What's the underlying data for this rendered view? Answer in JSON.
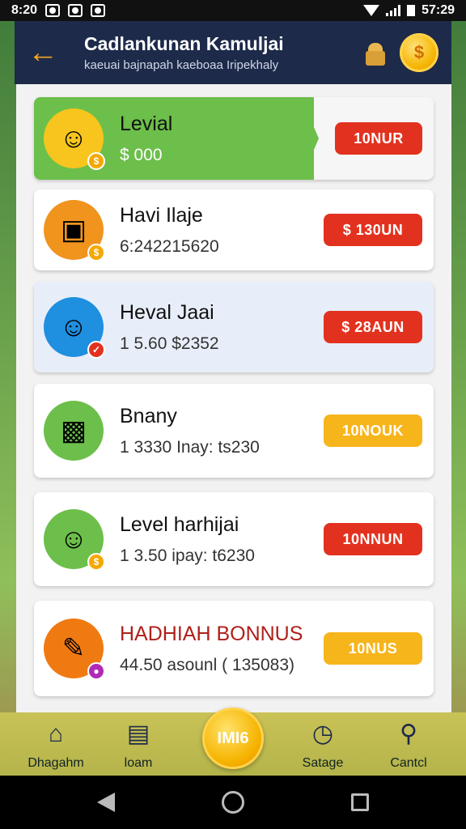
{
  "status_bar": {
    "time_left": "8:20",
    "time_right": "57:29"
  },
  "header": {
    "title": "Cadlankunan Kamuljai",
    "subtitle": "kaeuai bajnapah kaeboaa Iripekhaly",
    "back_icon": "arrow-left-icon",
    "gift_icon": "gift-box-icon",
    "coin_icon": "gold-coin-icon"
  },
  "cards": [
    {
      "title": "Levial",
      "subtitle": "$ 000",
      "button": "10NUR",
      "button_color": "#e2321f",
      "avatar_icon": "boy-avatar-icon"
    },
    {
      "title": "Havi Ilaje",
      "subtitle": "6:242215620",
      "button": "$ 130UN",
      "button_color": "#e2321f",
      "avatar_icon": "tablet-avatar-icon"
    },
    {
      "title": "Heval Jaai",
      "subtitle": "1 5.60  $2352",
      "button": "$ 28AUN",
      "button_color": "#e2321f",
      "avatar_icon": "boy-avatar-icon"
    },
    {
      "title": "Bnany",
      "subtitle": "1 3330  Inay: ts230",
      "button": "10NOUK",
      "button_color": "#f7b51c",
      "avatar_icon": "photo-card-icon"
    },
    {
      "title": "Level harhijai",
      "subtitle": "1 3.50  ipay: t6230",
      "button": "10NNUN",
      "button_color": "#e2321f",
      "avatar_icon": "boy-avatar-icon"
    },
    {
      "title": "HADHIAH BONNUS",
      "subtitle": "44.50  asounl ( 135083)",
      "button": "10NUS",
      "button_color": "#f7b51c",
      "avatar_icon": "tablet-pen-icon"
    }
  ],
  "bottom_nav": {
    "items": [
      {
        "label": "Dhagahm",
        "icon": "home-icon"
      },
      {
        "label": "loam",
        "icon": "document-icon"
      },
      {
        "label": "Satage",
        "icon": "clock-icon"
      },
      {
        "label": "Cantcl",
        "icon": "search-icon"
      }
    ],
    "center_label": "IMI6"
  }
}
